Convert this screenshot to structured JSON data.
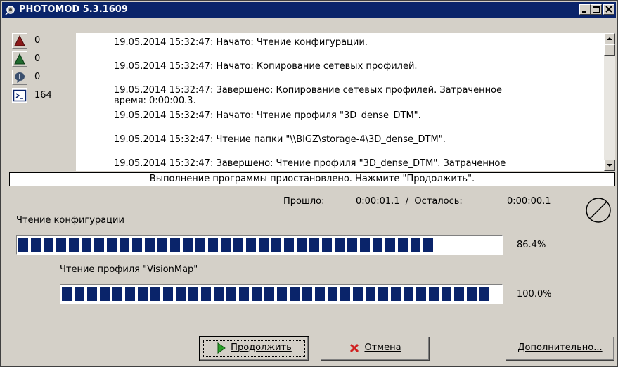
{
  "window": {
    "title": "PHOTOMOD 5.3.1609"
  },
  "counters": [
    {
      "icon": "error-triangle-icon",
      "color": "#8b1a1a",
      "value": "0"
    },
    {
      "icon": "warning-triangle-icon",
      "color": "#1f6b2e",
      "value": "0"
    },
    {
      "icon": "info-speech-icon",
      "color": "#3a4f6e",
      "value": "0"
    },
    {
      "icon": "console-icon",
      "color": "#0a246a",
      "value": "164"
    }
  ],
  "log": [
    {
      "line1": "19.05.2014 15:32:47: Начато: Чтение конфигурации.",
      "line2": ""
    },
    {
      "line1": "19.05.2014 15:32:47: Начато: Копирование сетевых профилей.",
      "line2": ""
    },
    {
      "line1": "19.05.2014 15:32:47: Завершено: Копирование сетевых профилей. Затраченное",
      "line2": "время: 0:00:00.3."
    },
    {
      "line1": "19.05.2014 15:32:47: Начато: Чтение профиля \"3D_dense_DTM\".",
      "line2": ""
    },
    {
      "line1": "19.05.2014 15:32:47: Чтение папки \"\\\\BIGZ\\storage-4\\3D_dense_DTM\".",
      "line2": ""
    },
    {
      "line1": "19.05.2014 15:32:47: Завершено: Чтение профиля \"3D_dense_DTM\". Затраченное",
      "line2": ""
    }
  ],
  "status_message": "Выполнение программы приостановлено. Нажмите \"Продолжить\".",
  "timing": {
    "elapsed_label": "Прошло:",
    "elapsed_value": "0:00:01.1  /  Осталось:",
    "remaining_value": "0:00:00.1"
  },
  "tasks": [
    {
      "label": "Чтение конфигурации",
      "percent_text": "86.4%",
      "progress": 0.864
    },
    {
      "label": "Чтение профиля \"VisionMap\"",
      "percent_text": "100.0%",
      "progress": 1.0
    }
  ],
  "buttons": {
    "continue_label": "Продолжить",
    "cancel_label": "Отмена",
    "more_label": "Дополнительно..."
  },
  "colors": {
    "title_bar": "#0a246a",
    "progress_fill": "#0a246a",
    "continue_arrow": "#2aa02a",
    "cancel_x": "#d02020"
  }
}
